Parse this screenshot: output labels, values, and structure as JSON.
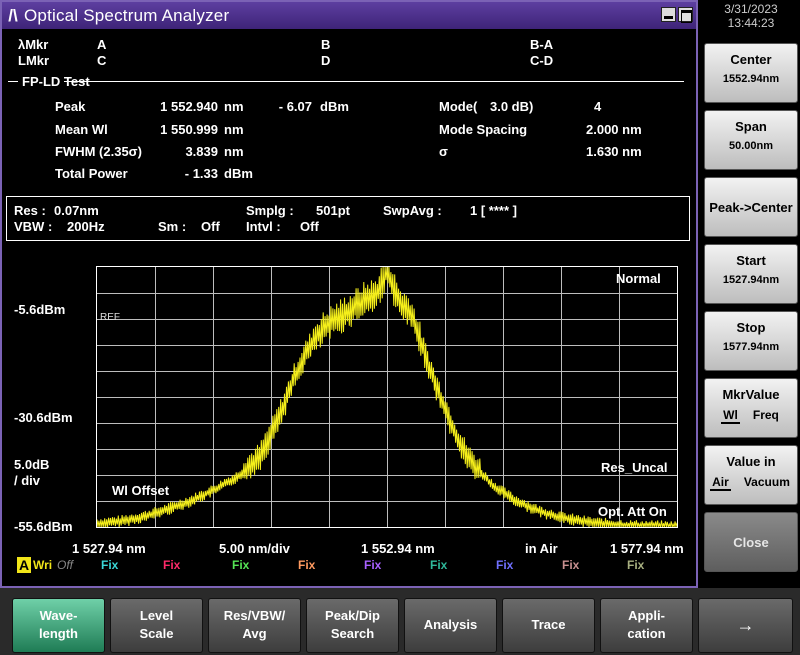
{
  "window": {
    "title": "Optical Spectrum Analyzer",
    "logo": "/\\"
  },
  "datetime": {
    "date": "3/31/2023",
    "time": "13:44:23"
  },
  "markers": {
    "lambda_label": "λMkr",
    "level_label": "LMkr",
    "a": "A",
    "b": "B",
    "ba": "B-A",
    "c": "C",
    "d": "D",
    "cd": "C-D"
  },
  "test": {
    "name": "FP-LD Test",
    "peak_label": "Peak",
    "peak_wl": "1 552.940",
    "peak_wl_unit": "nm",
    "peak_level": "- 6.07",
    "peak_level_unit": "dBm",
    "mean_label": "Mean Wl",
    "mean_wl": "1 550.999",
    "mean_unit": "nm",
    "fwhm_label": "FWHM (2.35σ)",
    "fwhm": "3.839",
    "fwhm_unit": "nm",
    "total_label": "Total Power",
    "total": "- 1.33",
    "total_unit": "dBm",
    "mode_label": "Mode(",
    "mode_db": "3.0  dB)",
    "mode_value": "4",
    "spacing_label": "Mode Spacing",
    "spacing": "2.000 nm",
    "sigma_label": "σ",
    "sigma": "1.630 nm"
  },
  "settings": {
    "res_label": "Res :",
    "res": "0.07nm",
    "vbw_label": "VBW :",
    "vbw": "200Hz",
    "smplg_label": "Smplg :",
    "smplg": "501pt",
    "swpavg_label": "SwpAvg :",
    "swpavg": "1 [     ****  ]",
    "sm_label": "Sm :",
    "sm": "Off",
    "intvl_label": "Intvl :",
    "intvl": "Off"
  },
  "plot": {
    "ref_level": "-5.6dBm",
    "mid_level": "-30.6dBm",
    "bottom_level": "-55.6dBm",
    "scale_line1": "5.0dB",
    "scale_line2": "/ div",
    "ref_marker": "REF",
    "mode_text": "Normal",
    "res_uncal": "Res_Uncal",
    "opt_att": "Opt. Att On",
    "wl_offset": "Wl Offset",
    "x_start": "1 527.94 nm",
    "x_div": "5.00 nm/div",
    "x_center": "1 552.94 nm",
    "x_medium": "in Air",
    "x_stop": "1 577.94 nm"
  },
  "traces": {
    "a_letter": "A",
    "a_mode": "Wri",
    "a_state": "Off",
    "items": [
      {
        "label": "Fix",
        "color": "#3ad6d6"
      },
      {
        "label": "Fix",
        "color": "#ff2a6a"
      },
      {
        "label": "Fix",
        "color": "#55e455"
      },
      {
        "label": "Fix",
        "color": "#ff9a60"
      },
      {
        "label": "Fix",
        "color": "#a860ff"
      },
      {
        "label": "Fix",
        "color": "#2fb89a"
      },
      {
        "label": "Fix",
        "color": "#7070ff"
      },
      {
        "label": "Fix",
        "color": "#c89090"
      },
      {
        "label": "Fix",
        "color": "#a8b080"
      }
    ]
  },
  "chart_data": {
    "type": "line",
    "title": "",
    "xlabel": "",
    "ylabel": "",
    "xlim": [
      1527.94,
      1577.94
    ],
    "ylim": [
      -55.6,
      -5.6
    ],
    "trace_color": "#f5ef1a",
    "grid": true,
    "series": [
      {
        "x": [
          1527.94,
          1530,
          1532,
          1534,
          1536,
          1538,
          1540,
          1542,
          1543,
          1544,
          1545,
          1546,
          1547,
          1548,
          1549,
          1550,
          1551,
          1552,
          1552.94,
          1554,
          1555,
          1556,
          1557,
          1558,
          1559,
          1560,
          1562,
          1564,
          1566,
          1568,
          1570,
          1572,
          1574,
          1576,
          1577.94
        ],
        "y": [
          -55,
          -54.5,
          -53.6,
          -52.2,
          -50.6,
          -48.5,
          -46,
          -42,
          -37.5,
          -32.5,
          -26.5,
          -22,
          -18.5,
          -16.5,
          -15,
          -13.5,
          -11.8,
          -11,
          -6.1,
          -12.5,
          -14.5,
          -21,
          -27.5,
          -33,
          -38.5,
          -42.5,
          -47.5,
          -50.5,
          -52.5,
          -53.8,
          -54.6,
          -55.1,
          -55.4,
          -55.5,
          -55.6
        ]
      }
    ]
  },
  "softkeys": {
    "center_label": "Center",
    "center_value": "1552.94nm",
    "span_label": "Span",
    "span_value": "50.00nm",
    "peak_center": "Peak->Center",
    "start_label": "Start",
    "start_value": "1527.94nm",
    "stop_label": "Stop",
    "stop_value": "1577.94nm",
    "mkrvalue_label": "MkrValue",
    "mkr_wl": "Wl",
    "mkr_freq": "Freq",
    "valuein_label": "Value in",
    "value_air": "Air",
    "value_vacuum": "Vacuum",
    "close": "Close"
  },
  "function_keys": {
    "wavelength_1": "Wave-",
    "wavelength_2": "length",
    "level_1": "Level",
    "level_2": "Scale",
    "res_1": "Res/VBW/",
    "res_2": "Avg",
    "peak_1": "Peak/Dip",
    "peak_2": "Search",
    "analysis": "Analysis",
    "trace": "Trace",
    "app_1": "Appli-",
    "app_2": "cation",
    "next": "→"
  }
}
